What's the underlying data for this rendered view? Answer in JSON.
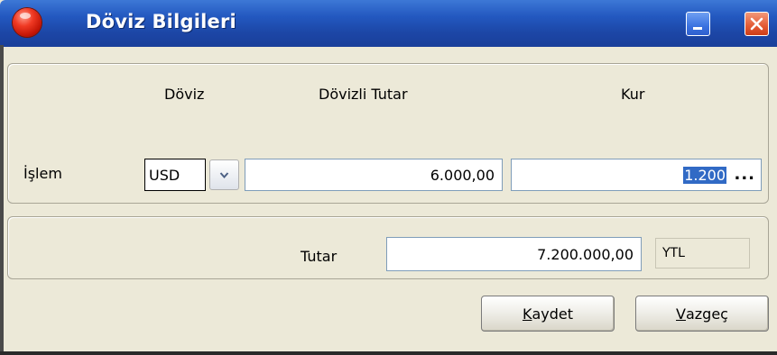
{
  "window": {
    "title": "Döviz Bilgileri"
  },
  "icons": {
    "app": "red-ball-icon",
    "minimize": "minimize-icon",
    "close": "close-icon",
    "dropdown": "chevron-down-icon"
  },
  "headers": {
    "doviz": "Döviz",
    "dovizli_tutar": "Dövizli Tutar",
    "kur": "Kur"
  },
  "islem": {
    "label": "İşlem",
    "currency": "USD",
    "amount": "6.000,00",
    "rate": "1.200",
    "rate_button": "..."
  },
  "total": {
    "label": "Tutar",
    "value": "7.200.000,00",
    "currency": "YTL"
  },
  "buttons": {
    "save_accel": "K",
    "save_rest": "aydet",
    "cancel_accel": "V",
    "cancel_rest": "azgeç"
  },
  "colors": {
    "titlebar": "#2358c0",
    "selection": "#316ac5",
    "face": "#ECE9D8"
  }
}
